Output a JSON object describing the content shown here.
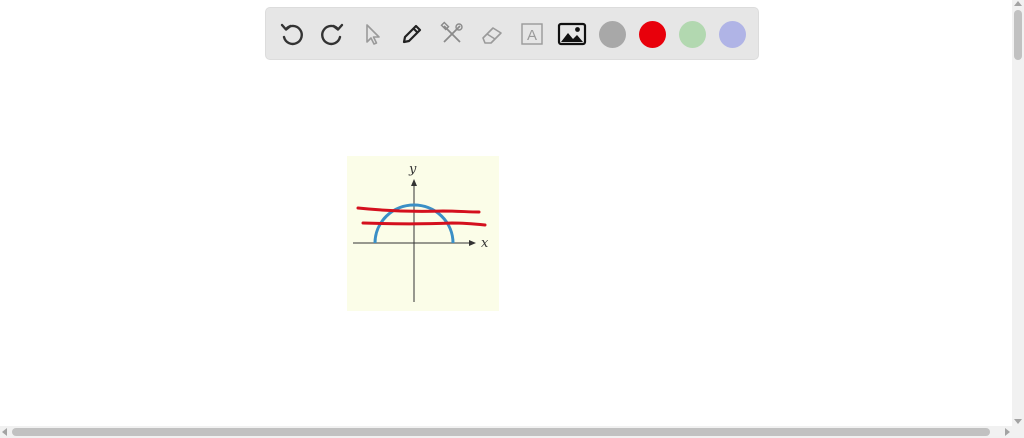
{
  "toolbar": {
    "tools": [
      {
        "name": "undo-icon"
      },
      {
        "name": "redo-icon"
      },
      {
        "name": "pointer-icon"
      },
      {
        "name": "pen-icon"
      },
      {
        "name": "tools-icon"
      },
      {
        "name": "eraser-icon"
      },
      {
        "name": "text-icon",
        "glyph": "A"
      },
      {
        "name": "image-icon"
      }
    ],
    "colors": {
      "gray": "#a8a8a8",
      "red": "#e8000b",
      "green": "#b2d8b0",
      "purple": "#b0b4e6"
    }
  },
  "figure": {
    "x_label": "x",
    "y_label": "y",
    "curve_color": "#3a8fc6",
    "stroke_color": "#d4101e",
    "background": "#fbfde8"
  }
}
